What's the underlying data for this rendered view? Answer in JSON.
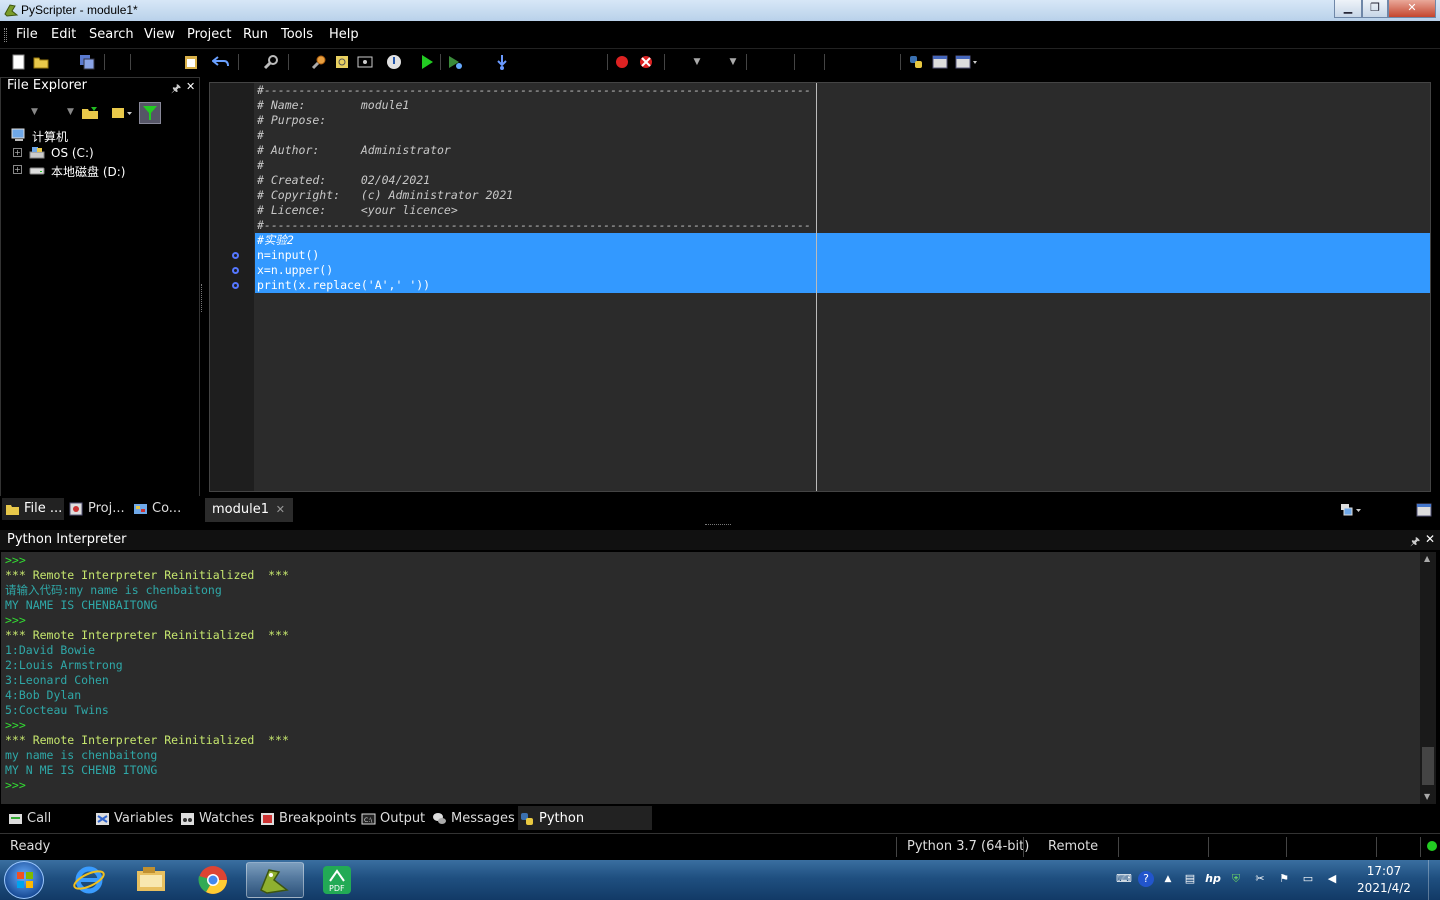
{
  "window": {
    "title": "PyScripter - module1*"
  },
  "menu": [
    "File",
    "Edit",
    "Search",
    "View",
    "Project",
    "Run",
    "Tools",
    "Help"
  ],
  "file_explorer": {
    "title": "File Explorer",
    "tree": [
      {
        "label": "计算机",
        "icon": "computer-icon"
      },
      {
        "label": "OS (C:)",
        "icon": "drive-icon"
      },
      {
        "label": "本地磁盘 (D:)",
        "icon": "drive-icon"
      }
    ],
    "tabs": [
      "File ...",
      "Proj...",
      "Co..."
    ]
  },
  "editor": {
    "lines": [
      "#-------------------------------------------------------------------------------",
      "# Name:        module1",
      "# Purpose:",
      "#",
      "# Author:      Administrator",
      "#",
      "# Created:     02/04/2021",
      "# Copyright:   (c) Administrator 2021",
      "# Licence:     <your licence>",
      "#-------------------------------------------------------------------------------",
      "#实验2",
      "n=input()",
      "x=n.upper()",
      "print(x.replace('A',' '))"
    ],
    "tab": "module1"
  },
  "interpreter": {
    "title": "Python Interpreter",
    "lines": [
      {
        "text": ">>>",
        "kind": "prompt"
      },
      {
        "text": "*** Remote Interpreter Reinitialized  ***",
        "kind": "banner"
      },
      {
        "text": "请输入代码:my name is chenbaitong",
        "kind": "out"
      },
      {
        "text": "MY NAME IS CHENBAITONG",
        "kind": "out"
      },
      {
        "text": ">>>",
        "kind": "prompt"
      },
      {
        "text": "*** Remote Interpreter Reinitialized  ***",
        "kind": "banner"
      },
      {
        "text": "1:David Bowie",
        "kind": "out"
      },
      {
        "text": "2:Louis Armstrong",
        "kind": "out"
      },
      {
        "text": "3:Leonard Cohen",
        "kind": "out"
      },
      {
        "text": "4:Bob Dylan",
        "kind": "out"
      },
      {
        "text": "5:Cocteau Twins",
        "kind": "out"
      },
      {
        "text": ">>>",
        "kind": "prompt"
      },
      {
        "text": "*** Remote Interpreter Reinitialized  ***",
        "kind": "banner"
      },
      {
        "text": "my name is chenbaitong",
        "kind": "out"
      },
      {
        "text": "MY N ME IS CHENB ITONG",
        "kind": "out"
      },
      {
        "text": ">>>",
        "kind": "prompt"
      }
    ]
  },
  "bottom_tabs": [
    "Call Stack",
    "Variables",
    "Watches",
    "Breakpoints",
    "Output",
    "Messages",
    "Python Interpreter"
  ],
  "status": {
    "text": "Ready",
    "python": "Python 3.7 (64-bit)",
    "mode": "Remote"
  },
  "clock": {
    "time": "17:07",
    "date": "2021/4/2"
  },
  "colors": {
    "selection": "#3399ff",
    "editor_bg": "#2b2b2b",
    "prompt": "#33dd33",
    "banner": "#c6e66e",
    "output": "#2fa8a8"
  }
}
